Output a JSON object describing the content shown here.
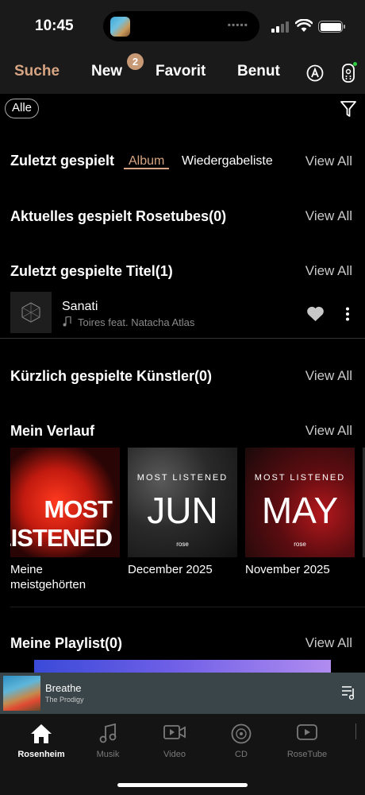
{
  "status_bar": {
    "time": "10:45"
  },
  "top_nav": {
    "tabs": [
      {
        "label": "Suche",
        "active": true
      },
      {
        "label": "New",
        "badge": "2"
      },
      {
        "label": "Favorit"
      },
      {
        "label": "Benut"
      }
    ],
    "icons": [
      "a-circle-icon",
      "remote-icon"
    ]
  },
  "filter": {
    "chip_label": "Alle",
    "icon": "filter-funnel-icon"
  },
  "sections": {
    "recent_played": {
      "title": "Zuletzt gespielt",
      "tabs": [
        "Album",
        "Wiedergabeliste"
      ],
      "active_tab": "Album",
      "view_all": "View All"
    },
    "rosetubes": {
      "title": "Aktuelles gespielt Rosetubes(0)",
      "view_all": "View All"
    },
    "recent_tracks": {
      "title": "Zuletzt gespielte Titel(1)",
      "view_all": "View All",
      "tracks": [
        {
          "name": "Sanati",
          "artist": "Toires feat. Natacha Atlas"
        }
      ]
    },
    "recent_artists": {
      "title": "Kürzlich gespielte Künstler(0)",
      "view_all": "View All"
    },
    "history": {
      "title": "Mein Verlauf",
      "view_all": "View All",
      "cards": [
        {
          "art_line1": "MOST",
          "art_line2": "LISTENED",
          "label": "Meine meistgehörten"
        },
        {
          "art_small": "MOST LISTENED",
          "art_big": "JUN",
          "art_brand": "rose",
          "label": "December 2025"
        },
        {
          "art_small": "MOST LISTENED",
          "art_big": "MAY",
          "art_brand": "rose",
          "label": "November 2025"
        }
      ]
    },
    "playlists": {
      "title": "Meine Playlist(0)",
      "view_all": "View All"
    }
  },
  "mini_player": {
    "title": "Breathe",
    "artist": "The Prodigy"
  },
  "bottom_nav": {
    "items": [
      {
        "label": "Rosenheim",
        "icon": "home-icon",
        "active": true
      },
      {
        "label": "Musik",
        "icon": "music-note-icon"
      },
      {
        "label": "Video",
        "icon": "video-icon"
      },
      {
        "label": "CD",
        "icon": "cd-icon"
      },
      {
        "label": "RoseTube",
        "icon": "rosetube-icon"
      }
    ]
  },
  "colors": {
    "accent": "#d7a583",
    "background": "#000000",
    "header": "#1a1a1a"
  }
}
